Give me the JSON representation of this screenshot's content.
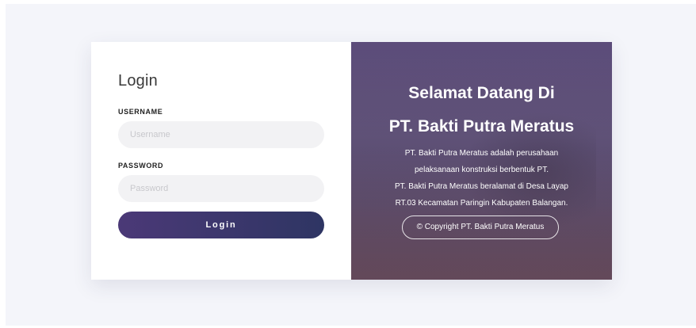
{
  "login": {
    "title": "Login",
    "username_label": "USERNAME",
    "username_placeholder": "Username",
    "password_label": "PASSWORD",
    "password_placeholder": "Password",
    "button_label": "Login"
  },
  "welcome": {
    "line1": "Selamat Datang Di",
    "line2": "PT. Bakti Putra Meratus",
    "description": [
      "PT. Bakti Putra Meratus adalah perusahaan",
      "pelaksanaan konstruksi berbentuk PT.",
      "PT. Bakti Putra Meratus beralamat di Desa Layap",
      "RT.03 Kecamatan Paringin Kabupaten Balangan."
    ],
    "copyright": "© Copyright PT. Bakti Putra Meratus"
  },
  "colors": {
    "button_gradient_start": "#4b3977",
    "button_gradient_end": "#2e3563",
    "panel_overlay": "#4e3e70"
  }
}
